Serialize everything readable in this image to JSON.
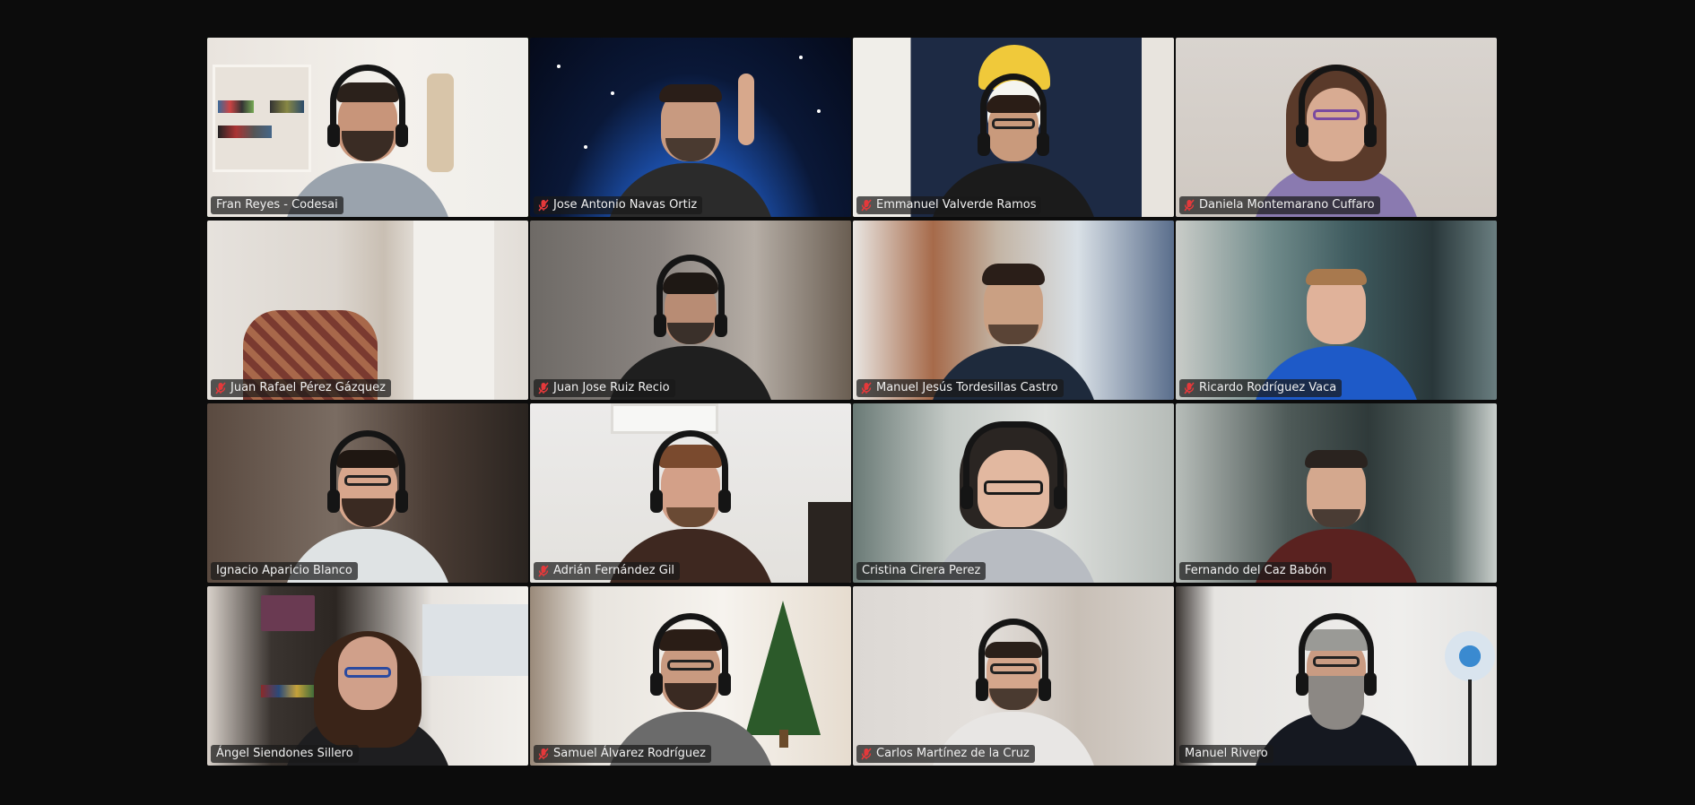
{
  "meeting": {
    "active_speaker": "Fran Reyes - Codesai",
    "colors": {
      "background": "#0c0c0c",
      "active_speaker_border": "#3ad15a",
      "muted_icon": "#e5393b",
      "label_bg": "rgba(25,25,25,0.72)"
    },
    "participants": [
      {
        "name": "Fran Reyes - Codesai",
        "muted": false,
        "speaking": true
      },
      {
        "name": "Jose Antonio Navas Ortiz",
        "muted": true,
        "speaking": false
      },
      {
        "name": "Emmanuel Valverde Ramos",
        "muted": true,
        "speaking": false
      },
      {
        "name": "Daniela Montemarano Cuffaro",
        "muted": true,
        "speaking": false
      },
      {
        "name": "Juan Rafael Pérez Gázquez",
        "muted": true,
        "speaking": false
      },
      {
        "name": "Juan Jose Ruiz Recio",
        "muted": true,
        "speaking": false
      },
      {
        "name": "Manuel Jesús Tordesillas Castro",
        "muted": true,
        "speaking": false
      },
      {
        "name": "Ricardo Rodríguez Vaca",
        "muted": true,
        "speaking": false
      },
      {
        "name": "Ignacio Aparicio Blanco",
        "muted": false,
        "speaking": false
      },
      {
        "name": "Adrián Fernández Gil",
        "muted": true,
        "speaking": false
      },
      {
        "name": "Cristina Cirera Perez",
        "muted": false,
        "speaking": false
      },
      {
        "name": "Fernando del Caz Babón",
        "muted": false,
        "speaking": false
      },
      {
        "name": "Ángel Siendones Sillero",
        "muted": false,
        "speaking": false
      },
      {
        "name": "Samuel Álvarez Rodríguez",
        "muted": true,
        "speaking": false
      },
      {
        "name": "Carlos Martínez de la Cruz",
        "muted": true,
        "speaking": false
      },
      {
        "name": "Manuel Rivero",
        "muted": false,
        "speaking": false
      }
    ]
  }
}
